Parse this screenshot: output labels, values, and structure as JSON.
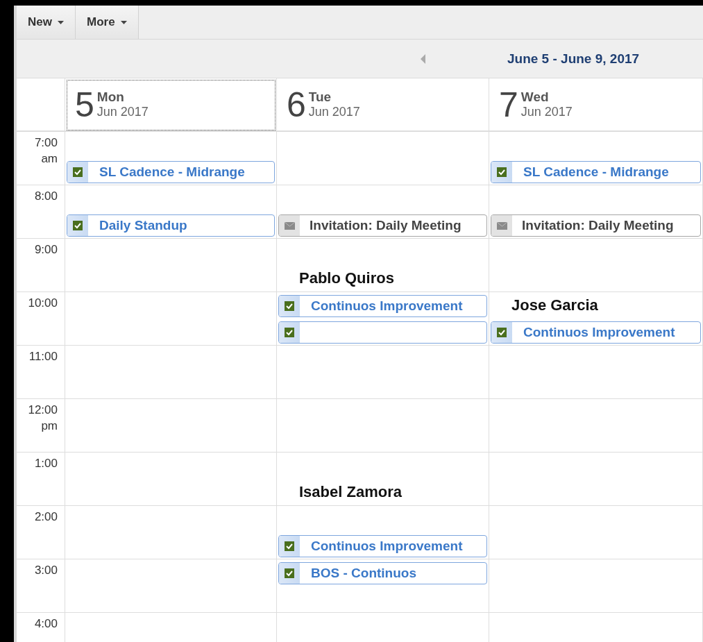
{
  "toolbar": {
    "buttons": [
      {
        "label": "New"
      },
      {
        "label": "More"
      }
    ]
  },
  "nav": {
    "title": "June 5 - June 9, 2017"
  },
  "days": [
    {
      "number": "5",
      "weekday": "Mon",
      "month": "Jun 2017",
      "selected": true
    },
    {
      "number": "6",
      "weekday": "Tue",
      "month": "Jun 2017",
      "selected": false
    },
    {
      "number": "7",
      "weekday": "Wed",
      "month": "Jun 2017",
      "selected": false
    }
  ],
  "rows": [
    {
      "time": "7:00",
      "suffix": "am",
      "cells": [
        {
          "bottom": [
            {
              "kind": "task",
              "title": "SL Cadence - Midrange"
            }
          ]
        },
        {},
        {
          "bottom": [
            {
              "kind": "task",
              "title": "SL Cadence - Midrange"
            }
          ]
        }
      ]
    },
    {
      "time": "8:00",
      "cells": [
        {
          "bottom": [
            {
              "kind": "task",
              "title": "Daily Standup"
            }
          ]
        },
        {
          "bottom": [
            {
              "kind": "invitation",
              "title": "Invitation: Daily Meeting"
            }
          ]
        },
        {
          "bottom": [
            {
              "kind": "invitation",
              "title": "Invitation: Daily Meeting"
            }
          ]
        }
      ]
    },
    {
      "time": "9:00",
      "cells": [
        {},
        {
          "bottom": [
            {
              "kind": "person",
              "title": "Pablo Quiros"
            }
          ]
        },
        {}
      ]
    },
    {
      "time": "10:00",
      "cells": [
        {},
        {
          "top": [
            {
              "kind": "task",
              "title": "Continuos Improvement"
            }
          ],
          "bottom": [
            {
              "kind": "task"
            }
          ]
        },
        {
          "top": [
            {
              "kind": "person",
              "title": "Jose Garcia"
            }
          ],
          "bottom": [
            {
              "kind": "task",
              "title": "Continuos Improvement"
            }
          ]
        }
      ]
    },
    {
      "time": "11:00",
      "cells": [
        {},
        {},
        {}
      ]
    },
    {
      "time": "12:00",
      "suffix": "pm",
      "cells": [
        {},
        {},
        {}
      ]
    },
    {
      "time": "1:00",
      "cells": [
        {},
        {
          "bottom": [
            {
              "kind": "person",
              "title": "Isabel Zamora"
            }
          ]
        },
        {}
      ]
    },
    {
      "time": "2:00",
      "cells": [
        {},
        {
          "bottom": [
            {
              "kind": "task",
              "title": "Continuos Improvement"
            }
          ]
        },
        {}
      ]
    },
    {
      "time": "3:00",
      "cells": [
        {},
        {
          "top": [
            {
              "kind": "task",
              "title": "BOS - Continuos"
            }
          ]
        },
        {}
      ]
    },
    {
      "time": "4:00",
      "cells": [
        {},
        {},
        {}
      ]
    }
  ]
}
